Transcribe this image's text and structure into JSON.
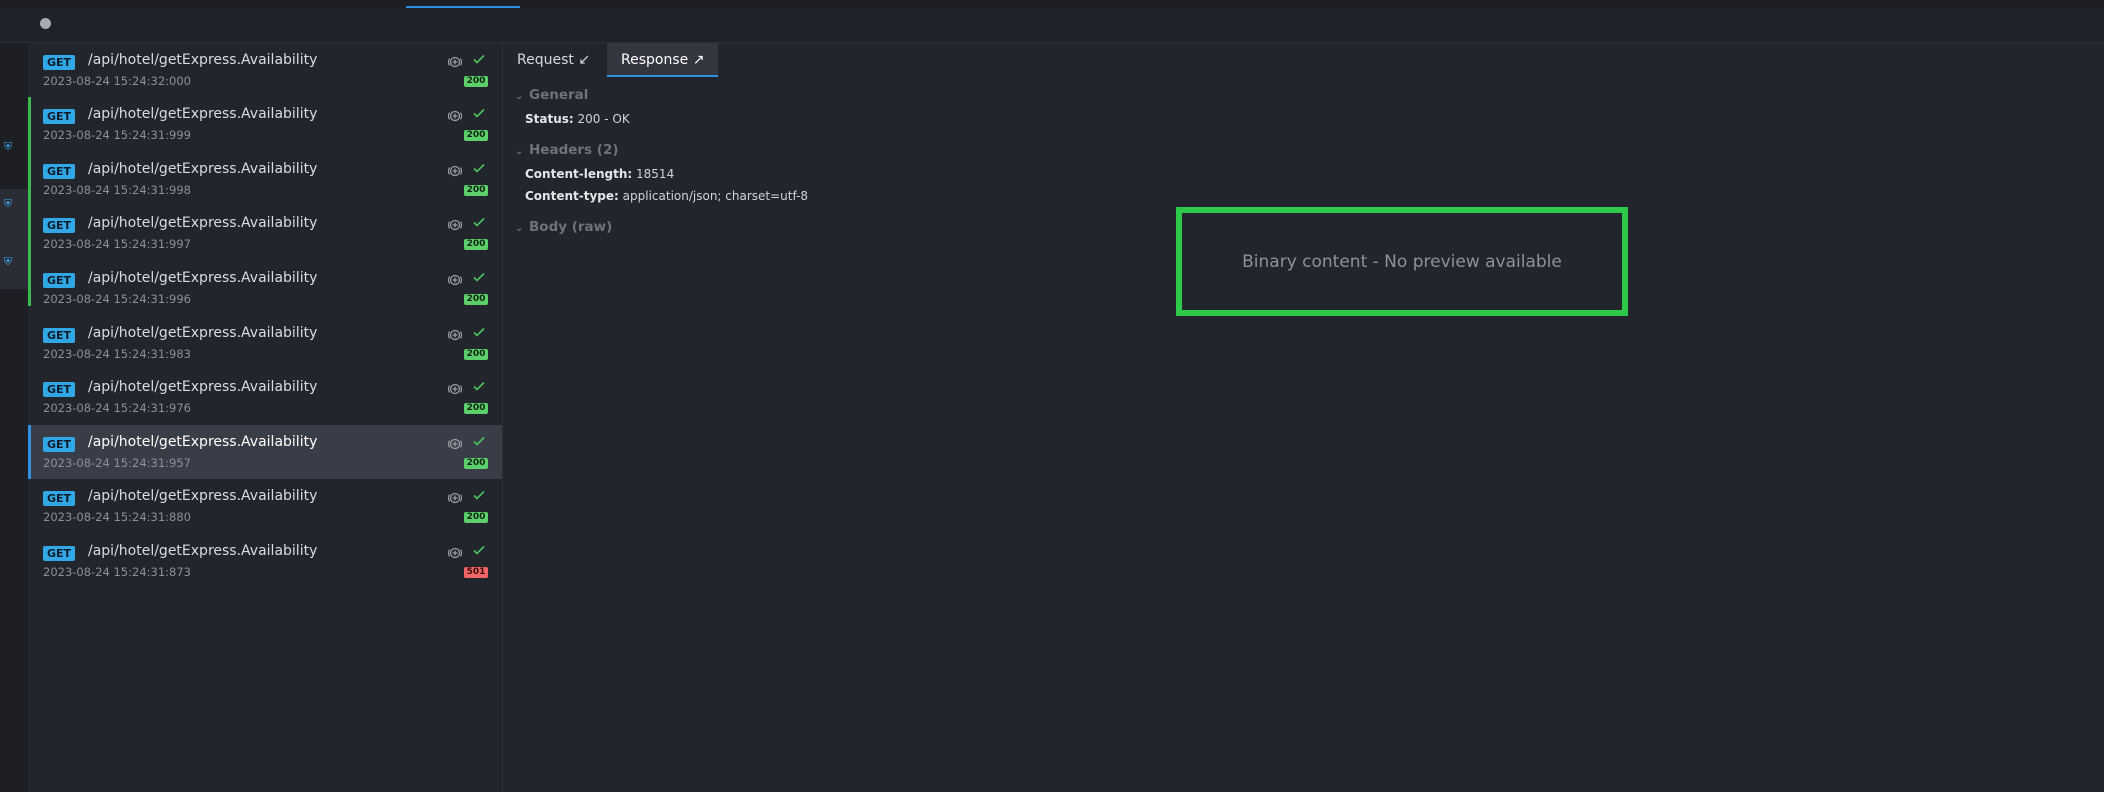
{
  "list": {
    "items": [
      {
        "method": "GET",
        "path": "/api/hotel/getExpress.Availability",
        "time": "2023-08-24 15:24:32:000",
        "status": "200"
      },
      {
        "method": "GET",
        "path": "/api/hotel/getExpress.Availability",
        "time": "2023-08-24 15:24:31:999",
        "status": "200"
      },
      {
        "method": "GET",
        "path": "/api/hotel/getExpress.Availability",
        "time": "2023-08-24 15:24:31:998",
        "status": "200"
      },
      {
        "method": "GET",
        "path": "/api/hotel/getExpress.Availability",
        "time": "2023-08-24 15:24:31:997",
        "status": "200"
      },
      {
        "method": "GET",
        "path": "/api/hotel/getExpress.Availability",
        "time": "2023-08-24 15:24:31:996",
        "status": "200"
      },
      {
        "method": "GET",
        "path": "/api/hotel/getExpress.Availability",
        "time": "2023-08-24 15:24:31:983",
        "status": "200"
      },
      {
        "method": "GET",
        "path": "/api/hotel/getExpress.Availability",
        "time": "2023-08-24 15:24:31:976",
        "status": "200"
      },
      {
        "method": "GET",
        "path": "/api/hotel/getExpress.Availability",
        "time": "2023-08-24 15:24:31:957",
        "status": "200"
      },
      {
        "method": "GET",
        "path": "/api/hotel/getExpress.Availability",
        "time": "2023-08-24 15:24:31:880",
        "status": "200"
      },
      {
        "method": "GET",
        "path": "/api/hotel/getExpress.Availability",
        "time": "2023-08-24 15:24:31:873",
        "status": "501"
      }
    ]
  },
  "detail": {
    "tabs": {
      "request": "Request",
      "request_arrow": "↙",
      "response": "Response",
      "response_arrow": "↗"
    },
    "general": {
      "heading": "General",
      "status_key": "Status:",
      "status_value": "200 - OK"
    },
    "headers": {
      "heading": "Headers (2)",
      "rows": [
        {
          "key": "Content-length:",
          "value": "18514"
        },
        {
          "key": "Content-type:",
          "value": "application/json; charset=utf-8"
        }
      ]
    },
    "body": {
      "heading": "Body (raw)",
      "placeholder": "Binary content - No preview available"
    }
  },
  "icons": {
    "section_chevron": "⌄",
    "rail_shield": "⛨"
  },
  "colors": {
    "accent_blue": "#2f8fe0",
    "method_get": "#31a7e6",
    "status_ok": "#5ccf6a",
    "status_error": "#f06565",
    "highlight_green": "#2fc94a"
  }
}
